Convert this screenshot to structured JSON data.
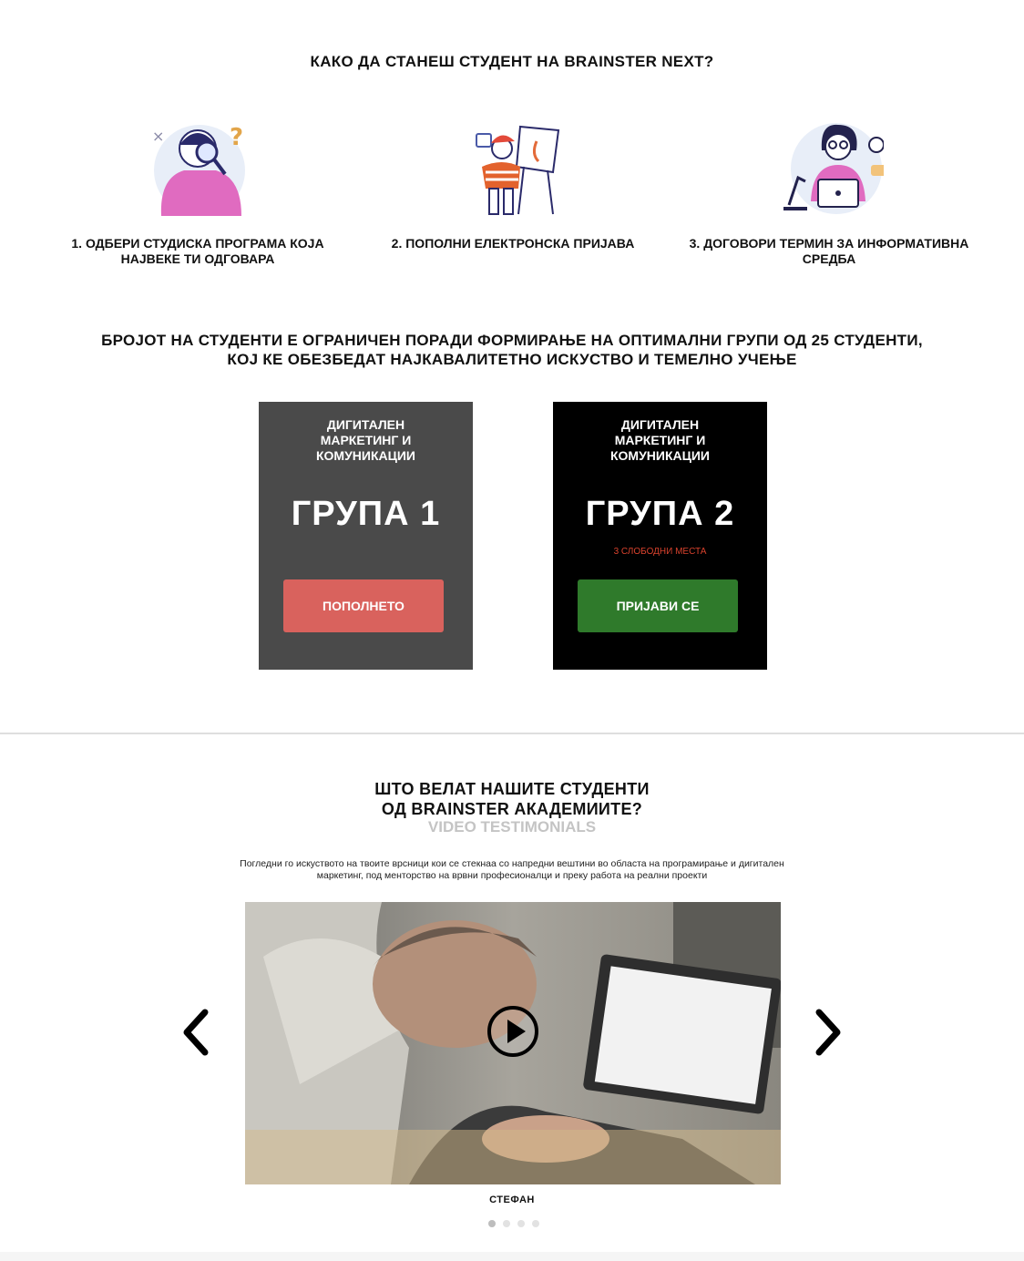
{
  "how": {
    "title": "КАКО ДА СТАНЕШ СТУДЕНТ НА BRAINSTER NEXT?",
    "steps": [
      {
        "label": "1. ОДБЕРИ СТУДИСКА ПРОГРАМА КОЈА НАЈВЕКЕ ТИ ОДГОВАРА",
        "icon": "person-magnifier-illustration"
      },
      {
        "label": "2. ПОПОЛНИ ЕЛЕКТРОНСКА ПРИЈАВА",
        "icon": "painter-easel-illustration"
      },
      {
        "label": "3. ДОГОВОРИ ТЕРМИН ЗА ИНФОРМАТИВНА СРЕДБА",
        "icon": "person-laptop-illustration"
      }
    ]
  },
  "limit": {
    "text": "БРОЈОТ НА СТУДЕНТИ Е ОГРАНИЧЕН ПОРАДИ ФОРМИРАЊЕ НА ОПТИМАЛНИ ГРУПИ ОД 25 СТУДЕНТИ, КОЈ КЕ ОБЕЗБЕДАТ НАЈКАВАЛИТЕТНО ИСКУСТВО И ТЕМЕЛНО УЧЕЊЕ"
  },
  "groups": [
    {
      "program": "ДИГИТАЛЕН МАРКЕТИНГ И КОМУНИКАЦИИ",
      "name": "ГРУПА 1",
      "seats": "",
      "button": "ПОПОЛНЕТО",
      "button_color": "#d9625d",
      "card_color": "#4a4a4a"
    },
    {
      "program": "ДИГИТАЛЕН МАРКЕТИНГ И КОМУНИКАЦИИ",
      "name": "ГРУПА 2",
      "seats": "3 СЛОБОДНИ МЕСТА",
      "button": "ПРИЈАВИ СЕ",
      "button_color": "#2f7a2b",
      "card_color": "#000000"
    }
  ],
  "testimonials": {
    "title_line1": "ШТО ВЕЛАТ НАШИТЕ СТУДЕНТИ",
    "title_line2": "ОД BRAINSTER АКАДЕМИИТЕ?",
    "subtitle": "VIDEO TESTIMONIALS",
    "description": "Погледни го искуството на твоите врсници кои се стекнаа со напредни вештини во областа на програмирање и дигитален маркетинг, под менторство на врвни професионалци и преку работа на реални проекти",
    "student_name": "СТЕФАН",
    "slide_count": 4,
    "active_slide": 1
  },
  "colors": {
    "accent_red": "#d8422d",
    "text": "#111111",
    "muted": "#c4c4c4"
  }
}
